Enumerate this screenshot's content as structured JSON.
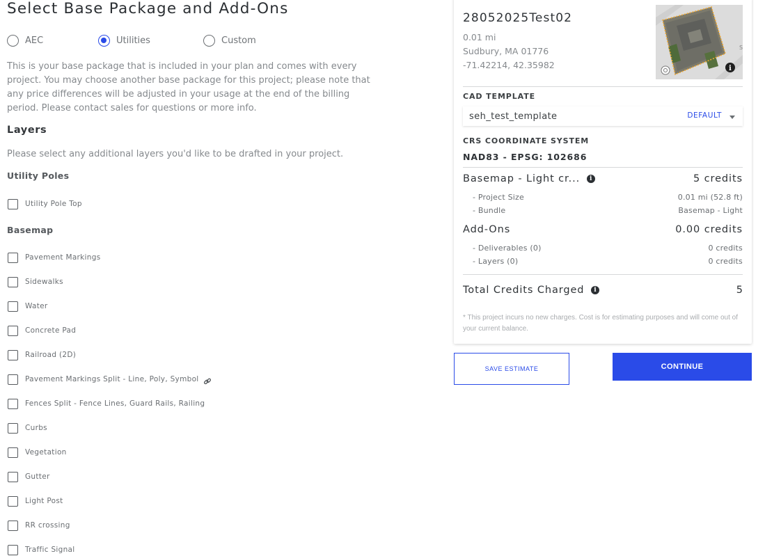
{
  "page": {
    "title": "Select Base Package and Add-Ons"
  },
  "package_options": [
    {
      "label": "AEC",
      "selected": false
    },
    {
      "label": "Utilities",
      "selected": true
    },
    {
      "label": "Custom",
      "selected": false
    }
  ],
  "package_description": "This is your base package that is included in your plan and comes with every project. You may choose another base package for this project; please note that any price differences will be adjusted in your usage at the end of the billing period. Please contact sales for questions or more info.",
  "layers": {
    "title": "Layers",
    "description": "Please select any additional layers you'd like to be drafted in your project.",
    "groups": [
      {
        "title": "Utility Poles",
        "items": [
          {
            "label": "Utility Pole Top",
            "checked": false
          }
        ]
      },
      {
        "title": "Basemap",
        "items": [
          {
            "label": "Pavement Markings",
            "checked": false
          },
          {
            "label": "Sidewalks",
            "checked": false
          },
          {
            "label": "Water",
            "checked": false
          },
          {
            "label": "Concrete Pad",
            "checked": false
          },
          {
            "label": "Railroad (2D)",
            "checked": false
          },
          {
            "label": "Pavement Markings Split - Line, Poly, Symbol",
            "checked": false,
            "icon": "link-icon"
          },
          {
            "label": "Fences Split - Fence Lines, Guard Rails, Railing",
            "checked": false
          },
          {
            "label": "Curbs",
            "checked": false
          },
          {
            "label": "Vegetation",
            "checked": false
          },
          {
            "label": "Gutter",
            "checked": false
          },
          {
            "label": "Light Post",
            "checked": false
          },
          {
            "label": "RR crossing",
            "checked": false
          },
          {
            "label": "Traffic Signal",
            "checked": false
          }
        ]
      }
    ]
  },
  "project": {
    "name": "28052025Test02",
    "size": "0.01 mi",
    "location": "Sudbury, MA 01776",
    "coordinates": "-71.42214, 42.35982"
  },
  "cad_template": {
    "label": "CAD TEMPLATE",
    "value": "seh_test_template",
    "tag": "DEFAULT"
  },
  "crs": {
    "label": "CRS COORDINATE SYSTEM",
    "value": "NAD83 - EPSG: 102686"
  },
  "summary": {
    "basemap_title": "Basemap - Light cr...",
    "basemap_credits": "5 credits",
    "basemap_rows": [
      {
        "label": "- Project Size",
        "value": "0.01 mi (52.8 ft)"
      },
      {
        "label": "- Bundle",
        "value": "Basemap - Light"
      }
    ],
    "addons_title": "Add-Ons",
    "addons_credits": "0.00 credits",
    "addons_rows": [
      {
        "label": "- Deliverables (0)",
        "value": "0 credits"
      },
      {
        "label": "- Layers (0)",
        "value": "0 credits"
      }
    ],
    "total_label": "Total Credits Charged",
    "total_value": "5",
    "note": "* This project incurs no new charges. Cost is for estimating purposes and will come out of your current balance."
  },
  "buttons": {
    "save_label": "SAVE ESTIMATE",
    "continue_label": "CONTINUE"
  },
  "colors": {
    "accent": "#2a4be8",
    "text_dark": "#2f3337",
    "text_muted": "#85898d"
  }
}
